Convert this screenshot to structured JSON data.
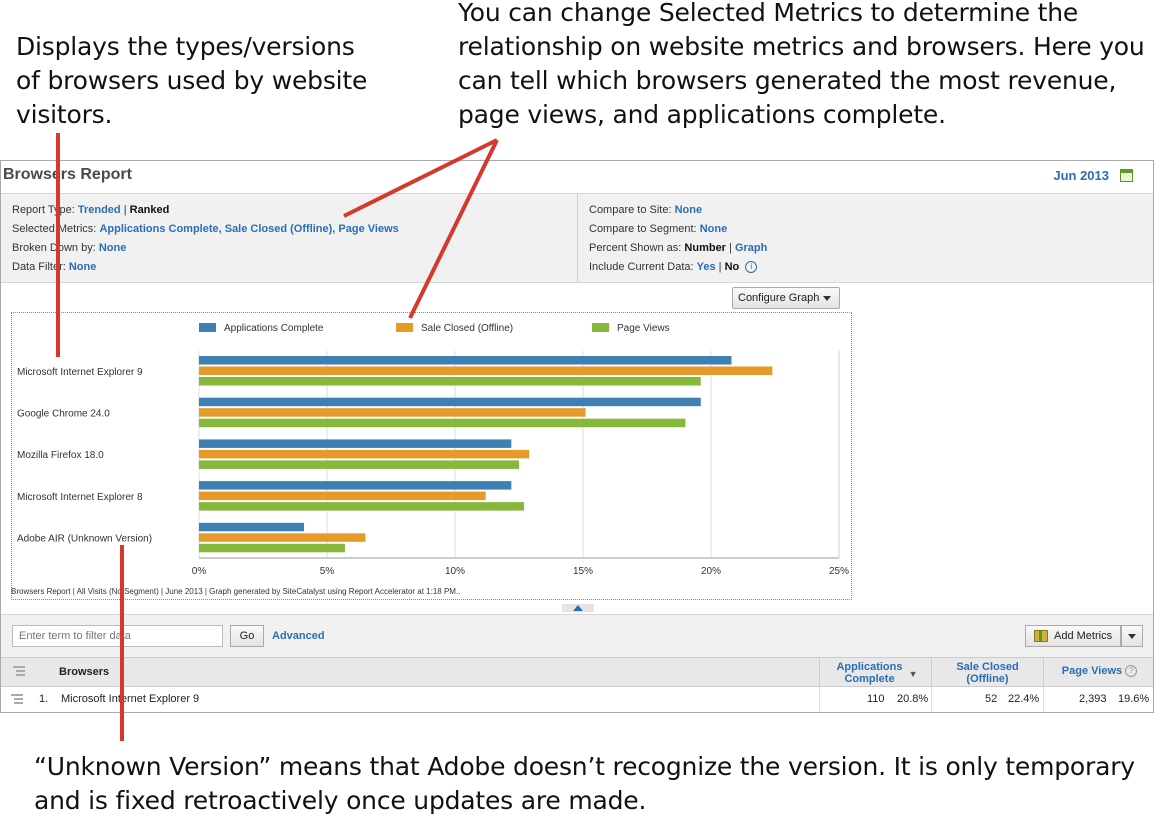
{
  "callouts": {
    "left": "Displays the types/versions of browsers used by website visitors.",
    "right": "You can change Selected Metrics to determine the relationship on website metrics and browsers. Here you can tell which browsers generated the most revenue, page views, and applications complete.",
    "bottom": "“Unknown Version” means that Adobe doesn’t recognize the version. It is only temporary and is fixed retroactively once updates are made."
  },
  "report": {
    "title": "Browsers Report",
    "date": "Jun 2013",
    "icons": {
      "calendar": "calendar-icon",
      "info": "info-icon",
      "add_metrics": "add-metrics-icon",
      "tree": "tree-icon"
    }
  },
  "settings_left": {
    "report_type_label": "Report Type:",
    "report_type_link": "Trended",
    "report_type_sep": "|",
    "report_type_active": "Ranked",
    "selected_metrics_label": "Selected Metrics:",
    "selected_metrics_value": "Applications Complete, Sale Closed (Offline), Page Views",
    "broken_down_label": "Broken Down by:",
    "broken_down_value": "None",
    "data_filter_label": "Data Filter:",
    "data_filter_value": "None"
  },
  "settings_right": {
    "compare_site_label": "Compare to Site:",
    "compare_site_value": "None",
    "compare_segment_label": "Compare to Segment:",
    "compare_segment_value": "None",
    "percent_label": "Percent Shown as:",
    "percent_active": "Number",
    "percent_sep": "|",
    "percent_link": "Graph",
    "include_label": "Include Current Data:",
    "include_link": "Yes",
    "include_sep": "|",
    "include_active": "No"
  },
  "configure_graph": "Configure Graph",
  "chart_data": {
    "type": "bar",
    "orientation": "horizontal",
    "categories": [
      "Microsoft Internet Explorer 9",
      "Google Chrome 24.0",
      "Mozilla Firefox 18.0",
      "Microsoft Internet Explorer 8",
      "Adobe AIR (Unknown Version)"
    ],
    "series": [
      {
        "name": "Applications Complete",
        "color": "#3d80b4",
        "values": [
          20.8,
          19.6,
          12.2,
          12.2,
          4.1
        ]
      },
      {
        "name": "Sale Closed (Offline)",
        "color": "#e69a2a",
        "values": [
          22.4,
          15.1,
          12.9,
          11.2,
          6.5
        ]
      },
      {
        "name": "Page Views",
        "color": "#86b83c",
        "values": [
          19.6,
          19.0,
          12.5,
          12.7,
          5.7
        ]
      }
    ],
    "x_ticks": [
      "0%",
      "5%",
      "10%",
      "15%",
      "20%",
      "25%"
    ],
    "xlim": [
      0,
      25
    ],
    "legend_position": "top",
    "grid": "vertical"
  },
  "chart_footer": "Browsers Report | All Visits (No Segment) | June 2013 | Graph generated by SiteCatalyst using Report Accelerator at  1:18 PM..",
  "filter": {
    "placeholder": "Enter term to filter data",
    "go": "Go",
    "advanced": "Advanced",
    "add_metrics": "Add Metrics"
  },
  "table": {
    "col_browsers": "Browsers",
    "col_apps": "Applications Complete",
    "col_sale": "Sale Closed (Offline)",
    "col_pv": "Page Views",
    "help_glyph": "?",
    "sort_glyph": "▼",
    "rows": [
      {
        "num": "1.",
        "name": "Microsoft Internet Explorer 9",
        "apps": "110",
        "apps_pct": "20.8%",
        "sale": "52",
        "sale_pct": "22.4%",
        "pv": "2,393",
        "pv_pct": "19.6%"
      }
    ]
  }
}
